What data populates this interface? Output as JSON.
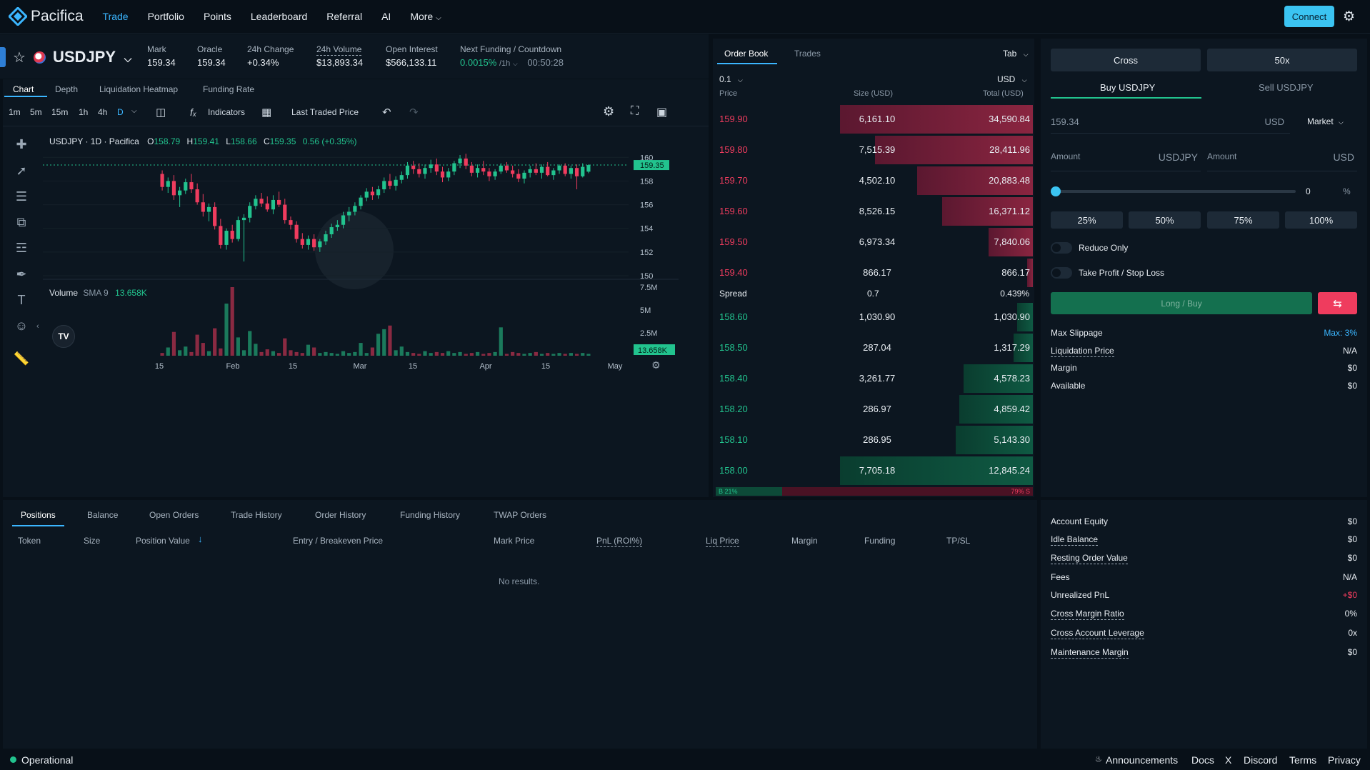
{
  "nav": {
    "brand": "Pacifica",
    "items": [
      "Trade",
      "Portfolio",
      "Points",
      "Leaderboard",
      "Referral",
      "AI",
      "More"
    ],
    "connect": "Connect"
  },
  "market": {
    "symbol": "USDJPY",
    "mark_label": "Mark",
    "mark": "159.34",
    "oracle_label": "Oracle",
    "oracle": "159.34",
    "change_label": "24h Change",
    "change": "+0.34%",
    "volume_label": "24h Volume",
    "volume": "$13,893.34",
    "oi_label": "Open Interest",
    "oi": "$566,133.11",
    "funding_label": "Next Funding / Countdown",
    "funding": "0.0015%",
    "funding_period": "/1h",
    "countdown": "00:50:28"
  },
  "chart_tabs": [
    "Chart",
    "Depth",
    "Liquidation Heatmap",
    "Funding Rate"
  ],
  "chart_toolbar": {
    "intervals": [
      "1m",
      "5m",
      "15m",
      "1h",
      "4h",
      "D"
    ],
    "indicators": "Indicators",
    "price_source": "Last Traded Price"
  },
  "chart_legend": {
    "title": "USDJPY · 1D · Pacifica",
    "o_label": "O",
    "o": "158.79",
    "h_label": "H",
    "h": "159.41",
    "l_label": "L",
    "l": "158.66",
    "c_label": "C",
    "c": "159.35",
    "chg": "0.56 (+0.35%)",
    "vol_label": "Volume",
    "vol_sma": "SMA 9",
    "vol_val": "13.658K"
  },
  "chart_data": {
    "type": "candlestick",
    "price_ticks": [
      "160",
      "158",
      "156",
      "154",
      "152",
      "150"
    ],
    "price_label": "159.35",
    "volume_ticks": [
      "7.5M",
      "5M",
      "2.5M"
    ],
    "volume_label": "13.658K",
    "x_ticks": [
      "15",
      "Feb",
      "15",
      "Mar",
      "15",
      "Apr",
      "15",
      "May"
    ],
    "ylim": [
      150,
      160.5
    ],
    "candles": [
      [
        158.6,
        158.9,
        157.2,
        157.5
      ],
      [
        157.5,
        158.3,
        157.0,
        158.0
      ],
      [
        158.0,
        158.5,
        156.4,
        156.8
      ],
      [
        156.8,
        157.5,
        155.8,
        157.2
      ],
      [
        157.2,
        158.2,
        156.9,
        157.9
      ],
      [
        157.9,
        158.6,
        157.0,
        157.3
      ],
      [
        157.3,
        157.8,
        156.0,
        156.2
      ],
      [
        156.2,
        156.9,
        155.0,
        155.4
      ],
      [
        155.4,
        156.1,
        154.6,
        155.8
      ],
      [
        155.8,
        156.2,
        153.9,
        154.2
      ],
      [
        154.2,
        154.8,
        152.3,
        152.6
      ],
      [
        152.6,
        154.0,
        152.2,
        153.8
      ],
      [
        153.8,
        154.3,
        152.8,
        153.1
      ],
      [
        153.1,
        155.0,
        152.9,
        154.7
      ],
      [
        154.7,
        155.2,
        151.2,
        154.9
      ],
      [
        154.9,
        156.2,
        154.5,
        155.9
      ],
      [
        155.9,
        156.8,
        155.6,
        156.5
      ],
      [
        156.5,
        157.0,
        155.8,
        156.1
      ],
      [
        156.1,
        156.7,
        155.4,
        155.6
      ],
      [
        155.6,
        156.8,
        155.2,
        156.4
      ],
      [
        156.4,
        157.1,
        155.8,
        156.0
      ],
      [
        156.0,
        156.5,
        154.4,
        154.7
      ],
      [
        154.7,
        155.0,
        153.9,
        154.3
      ],
      [
        154.3,
        154.6,
        152.8,
        153.1
      ],
      [
        153.1,
        153.6,
        152.3,
        152.6
      ],
      [
        152.6,
        153.4,
        152.2,
        153.1
      ],
      [
        153.1,
        153.5,
        152.1,
        152.4
      ],
      [
        152.4,
        153.1,
        152.0,
        152.9
      ],
      [
        152.9,
        153.8,
        152.6,
        153.5
      ],
      [
        153.5,
        154.4,
        153.2,
        154.1
      ],
      [
        154.1,
        154.7,
        153.8,
        154.3
      ],
      [
        154.3,
        155.4,
        154.0,
        155.1
      ],
      [
        155.1,
        155.8,
        154.6,
        155.4
      ],
      [
        155.4,
        156.2,
        155.1,
        155.9
      ],
      [
        155.9,
        156.8,
        155.6,
        156.6
      ],
      [
        156.6,
        157.4,
        156.3,
        157.1
      ],
      [
        157.1,
        157.5,
        156.4,
        156.8
      ],
      [
        156.8,
        157.6,
        156.5,
        157.3
      ],
      [
        157.3,
        158.3,
        157.0,
        158.0
      ],
      [
        158.0,
        158.6,
        157.3,
        157.6
      ],
      [
        157.6,
        158.4,
        157.2,
        158.1
      ],
      [
        158.1,
        158.8,
        157.8,
        158.5
      ],
      [
        158.5,
        159.6,
        158.2,
        159.3
      ],
      [
        159.3,
        159.7,
        158.6,
        159.0
      ],
      [
        159.0,
        159.5,
        158.3,
        158.6
      ],
      [
        158.6,
        159.4,
        158.2,
        159.1
      ],
      [
        159.1,
        159.8,
        158.7,
        159.4
      ],
      [
        159.4,
        159.9,
        158.5,
        158.8
      ],
      [
        158.8,
        159.2,
        157.9,
        158.3
      ],
      [
        158.3,
        159.1,
        158.0,
        158.8
      ],
      [
        158.8,
        159.7,
        158.5,
        159.5
      ],
      [
        159.5,
        160.2,
        159.1,
        159.9
      ],
      [
        159.9,
        160.3,
        159.0,
        159.3
      ],
      [
        159.3,
        159.6,
        158.4,
        158.7
      ],
      [
        158.7,
        159.4,
        158.3,
        159.1
      ],
      [
        159.1,
        159.7,
        158.5,
        158.8
      ],
      [
        158.8,
        159.1,
        158.0,
        158.4
      ],
      [
        158.4,
        159.0,
        158.1,
        158.8
      ],
      [
        158.8,
        159.5,
        158.6,
        159.3
      ],
      [
        159.3,
        159.6,
        158.7,
        158.9
      ],
      [
        158.9,
        159.3,
        158.3,
        158.6
      ],
      [
        158.6,
        159.0,
        157.9,
        158.2
      ],
      [
        158.2,
        158.9,
        157.8,
        158.7
      ],
      [
        158.7,
        159.3,
        158.3,
        159.0
      ],
      [
        159.0,
        159.5,
        158.5,
        158.7
      ],
      [
        158.7,
        159.4,
        158.2,
        159.2
      ],
      [
        159.2,
        159.6,
        158.4,
        158.5
      ],
      [
        158.5,
        159.1,
        158.1,
        158.9
      ],
      [
        158.9,
        159.4,
        158.6,
        159.3
      ],
      [
        159.3,
        159.5,
        158.4,
        158.6
      ],
      [
        158.6,
        159.3,
        158.2,
        159.1
      ],
      [
        159.1,
        159.4,
        157.3,
        158.4
      ],
      [
        158.4,
        159.5,
        158.3,
        159.2
      ],
      [
        158.79,
        159.41,
        158.66,
        159.35
      ]
    ],
    "volumes": [
      0.3,
      0.9,
      2.6,
      0.6,
      1.0,
      0.4,
      2.3,
      1.4,
      0.5,
      3.0,
      0.8,
      5.7,
      7.5,
      2.0,
      0.6,
      2.7,
      1.3,
      0.4,
      0.7,
      0.5,
      0.3,
      1.9,
      0.6,
      0.4,
      0.3,
      1.2,
      0.9,
      0.3,
      0.4,
      0.3,
      0.2,
      0.5,
      0.3,
      0.4,
      1.4,
      0.3,
      0.9,
      2.4,
      2.9,
      3.3,
      0.6,
      1.0,
      0.4,
      0.3,
      0.2,
      0.5,
      0.3,
      0.4,
      0.3,
      0.5,
      0.3,
      0.4,
      0.2,
      0.3,
      0.4,
      0.2,
      0.3,
      0.4,
      3.1,
      0.2,
      0.4,
      0.3,
      0.2,
      0.3,
      0.4,
      0.2,
      0.3,
      0.2,
      0.3,
      0.2,
      0.3,
      0.2,
      0.3,
      0.2,
      0.2
    ]
  },
  "orderbook": {
    "tabs": [
      "Order Book",
      "Trades"
    ],
    "tab_select": "Tab",
    "precision": "0.1",
    "currency": "USD",
    "headers": [
      "Price",
      "Size (USD)",
      "Total (USD)"
    ],
    "asks": [
      {
        "price": "159.90",
        "size": "6,161.10",
        "total": "34,590.84",
        "depth": 1.0
      },
      {
        "price": "159.80",
        "size": "7,515.39",
        "total": "28,411.96",
        "depth": 0.82
      },
      {
        "price": "159.70",
        "size": "4,502.10",
        "total": "20,883.48",
        "depth": 0.6
      },
      {
        "price": "159.60",
        "size": "8,526.15",
        "total": "16,371.12",
        "depth": 0.47
      },
      {
        "price": "159.50",
        "size": "6,973.34",
        "total": "7,840.06",
        "depth": 0.23
      },
      {
        "price": "159.40",
        "size": "866.17",
        "total": "866.17",
        "depth": 0.03
      }
    ],
    "spread_label": "Spread",
    "spread": "0.7",
    "spread_pct": "0.439%",
    "bids": [
      {
        "price": "158.60",
        "size": "1,030.90",
        "total": "1,030.90",
        "depth": 0.08
      },
      {
        "price": "158.50",
        "size": "287.04",
        "total": "1,317.29",
        "depth": 0.1
      },
      {
        "price": "158.40",
        "size": "3,261.77",
        "total": "4,578.23",
        "depth": 0.36
      },
      {
        "price": "158.20",
        "size": "286.97",
        "total": "4,859.42",
        "depth": 0.38
      },
      {
        "price": "158.10",
        "size": "286.95",
        "total": "5,143.30",
        "depth": 0.4
      },
      {
        "price": "158.00",
        "size": "7,705.18",
        "total": "12,845.24",
        "depth": 1.0
      }
    ],
    "ratio_b": "B 21%",
    "ratio_s": "79% S",
    "ratio_b_value": 0.21
  },
  "trade": {
    "margin_mode": "Cross",
    "leverage": "50x",
    "buy_tab": "Buy USDJPY",
    "sell_tab": "Sell USDJPY",
    "price": "159.34",
    "price_unit": "USD",
    "order_type": "Market",
    "amount_label": "Amount",
    "amount_unit1": "USDJPY",
    "amount_unit2": "USD",
    "slider_value": "0",
    "slider_unit": "%",
    "pcts": [
      "25%",
      "50%",
      "75%",
      "100%"
    ],
    "reduce_only": "Reduce Only",
    "tpsl": "Take Profit / Stop Loss",
    "submit": "Long / Buy",
    "info": [
      {
        "label": "Max Slippage",
        "value": "Max: 3%"
      },
      {
        "label": "Liquidation Price",
        "value": "N/A"
      },
      {
        "label": "Margin",
        "value": "$0"
      },
      {
        "label": "Available",
        "value": "$0"
      }
    ]
  },
  "bottom": {
    "tabs": [
      "Positions",
      "Balance",
      "Open Orders",
      "Trade History",
      "Order History",
      "Funding History",
      "TWAP Orders"
    ],
    "columns": [
      "Token",
      "Size",
      "Position Value",
      "Entry / Breakeven Price",
      "Mark Price",
      "PnL (ROI%)",
      "Liq Price",
      "Margin",
      "Funding",
      "TP/SL"
    ],
    "empty": "No results."
  },
  "account": [
    {
      "label": "Account Equity",
      "value": "$0"
    },
    {
      "label": "Idle Balance",
      "value": "$0"
    },
    {
      "label": "Resting Order Value",
      "value": "$0"
    },
    {
      "label": "Fees",
      "value": "N/A"
    },
    {
      "label": "Unrealized PnL",
      "value": "+$0"
    },
    {
      "label": "Cross Margin Ratio",
      "value": "0%"
    },
    {
      "label": "Cross Account Leverage",
      "value": "0x"
    },
    {
      "label": "Maintenance Margin",
      "value": "$0"
    }
  ],
  "footer": {
    "status": "Operational",
    "links": [
      "Announcements",
      "Docs",
      "X",
      "Discord",
      "Terms",
      "Privacy"
    ]
  }
}
